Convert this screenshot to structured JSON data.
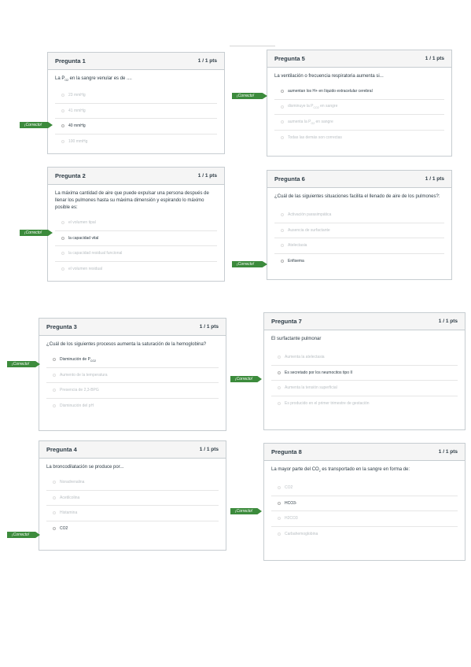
{
  "correct_label": "¡Correcto!",
  "questions": [
    {
      "title": "Pregunta 1",
      "pts": "1 / 1 pts",
      "text_parts": [
        "La P",
        "O2",
        " en la sangre venular es de ...."
      ],
      "answers": [
        "23 mmHg",
        "41 mmHg",
        "40 mmHg",
        "100 mmHg"
      ],
      "selected": 2
    },
    {
      "title": "Pregunta 2",
      "pts": "1 / 1 pts",
      "text": "La máxima cantidad de aire que puede expulsar una persona después de llenar los pulmones hasta su máxima dimensión y espirando lo máximo posible es:",
      "answers": [
        "el volumen tipal",
        "la capacidad vital",
        "la capacidad residual funcional",
        "el volumen residual"
      ],
      "selected": 1
    },
    {
      "title": "Pregunta 3",
      "pts": "1 / 1 pts",
      "text": "¿Cuál de los siguientes procesos aumenta la saturación de la hemoglobina?",
      "answers": [
        [
          "Disminución de P",
          "CO2",
          ""
        ],
        "Aumento de la temperatura",
        "Presencia de 2,3-BPG",
        "Disminución del pH"
      ],
      "selected": 0
    },
    {
      "title": "Pregunta 4",
      "pts": "1 / 1 pts",
      "text": "La broncodilatación se produce por...",
      "answers": [
        "Noradrenalina",
        "Acetilcolina",
        "Histamina",
        "CO2"
      ],
      "selected": 3
    },
    {
      "title": "Pregunta 5",
      "pts": "1 / 1 pts",
      "text": "La ventilación o frecuencia respiratoria aumenta si...",
      "answers": [
        "aumentan los H+ en líquido extracelular cerebral",
        [
          "disminuye la P",
          "CO2",
          " en sangre"
        ],
        [
          "aumenta la P",
          "O2",
          " en sangre"
        ],
        "Todas las demás son correctas"
      ],
      "selected": 0
    },
    {
      "title": "Pregunta 6",
      "pts": "1 / 1 pts",
      "text": "¿Cuál de las siguientes situaciones facilita el llenado de aire de los pulmones?:",
      "answers": [
        "Activación parasimpática",
        "Ausencia de surfactante",
        "Atelectasia",
        "Enfisema"
      ],
      "selected": 3
    },
    {
      "title": "Pregunta 7",
      "pts": "1 / 1 pts",
      "text": "El surfactante pulmonar",
      "answers": [
        "Aumenta la atelectasia",
        "Es secretado por los neumocitos tipo II",
        "Aumenta la tensión superficial",
        "Es producido en el primer trimestre de gestación"
      ],
      "selected": 1
    },
    {
      "title": "Pregunta 8",
      "pts": "1 / 1 pts",
      "text_parts": [
        "La mayor parte del CO",
        "2",
        " es transportado en la sangre en forma de:"
      ],
      "answers": [
        "CO2",
        "HCO3-",
        "H2CO3",
        "Carbahemoglobina"
      ],
      "selected": 1
    }
  ]
}
